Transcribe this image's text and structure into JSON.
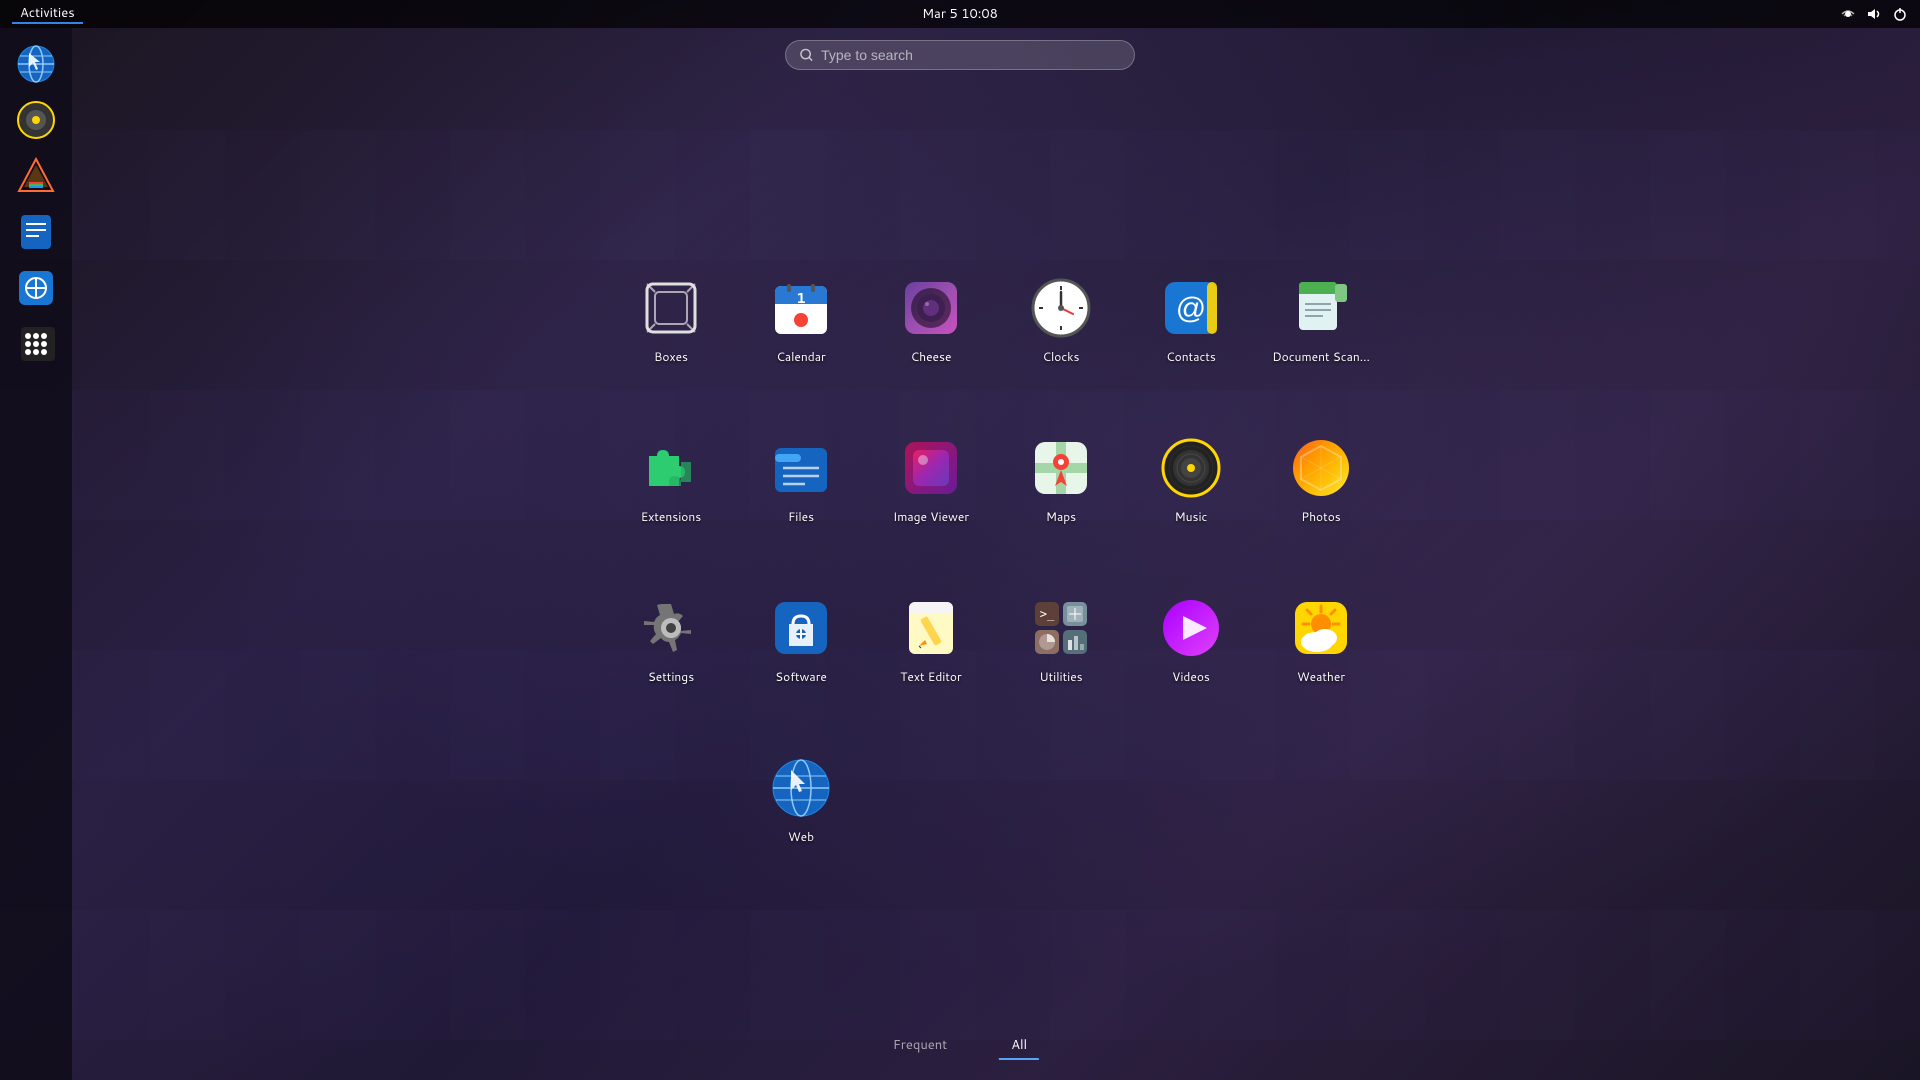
{
  "topbar": {
    "activities_label": "Activities",
    "datetime": "Mar 5  10:08"
  },
  "search": {
    "placeholder": "Type to search"
  },
  "apps": [
    {
      "id": "boxes",
      "label": "Boxes",
      "icon_type": "boxes"
    },
    {
      "id": "calendar",
      "label": "Calendar",
      "icon_type": "calendar"
    },
    {
      "id": "cheese",
      "label": "Cheese",
      "icon_type": "cheese"
    },
    {
      "id": "clocks",
      "label": "Clocks",
      "icon_type": "clocks"
    },
    {
      "id": "contacts",
      "label": "Contacts",
      "icon_type": "contacts"
    },
    {
      "id": "docscan",
      "label": "Document Scan...",
      "icon_type": "docscan"
    },
    {
      "id": "extensions",
      "label": "Extensions",
      "icon_type": "extensions"
    },
    {
      "id": "files",
      "label": "Files",
      "icon_type": "files"
    },
    {
      "id": "imageviewer",
      "label": "Image Viewer",
      "icon_type": "imageviewer"
    },
    {
      "id": "maps",
      "label": "Maps",
      "icon_type": "maps"
    },
    {
      "id": "music",
      "label": "Music",
      "icon_type": "music"
    },
    {
      "id": "photos",
      "label": "Photos",
      "icon_type": "photos"
    },
    {
      "id": "settings",
      "label": "Settings",
      "icon_type": "settings"
    },
    {
      "id": "software",
      "label": "Software",
      "icon_type": "software"
    },
    {
      "id": "texteditor",
      "label": "Text Editor",
      "icon_type": "texteditor"
    },
    {
      "id": "utilities",
      "label": "Utilities",
      "icon_type": "utilities"
    },
    {
      "id": "videos",
      "label": "Videos",
      "icon_type": "videos"
    },
    {
      "id": "weather",
      "label": "Weather",
      "icon_type": "weather"
    },
    {
      "id": "web",
      "label": "Web",
      "icon_type": "web"
    }
  ],
  "tabs": [
    {
      "id": "frequent",
      "label": "Frequent",
      "active": false
    },
    {
      "id": "all",
      "label": "All",
      "active": true
    }
  ],
  "sidebar": {
    "items": [
      {
        "id": "web",
        "label": "Web"
      },
      {
        "id": "rhythmbox",
        "label": "Music"
      },
      {
        "id": "prism",
        "label": "Prism"
      },
      {
        "id": "commander",
        "label": "Commander"
      },
      {
        "id": "software",
        "label": "Software"
      },
      {
        "id": "apps",
        "label": "All Apps"
      }
    ]
  },
  "colors": {
    "accent": "#3584e4",
    "topbar_bg": "rgba(0,0,0,0.7)",
    "tab_active": "#5ba3f5"
  }
}
